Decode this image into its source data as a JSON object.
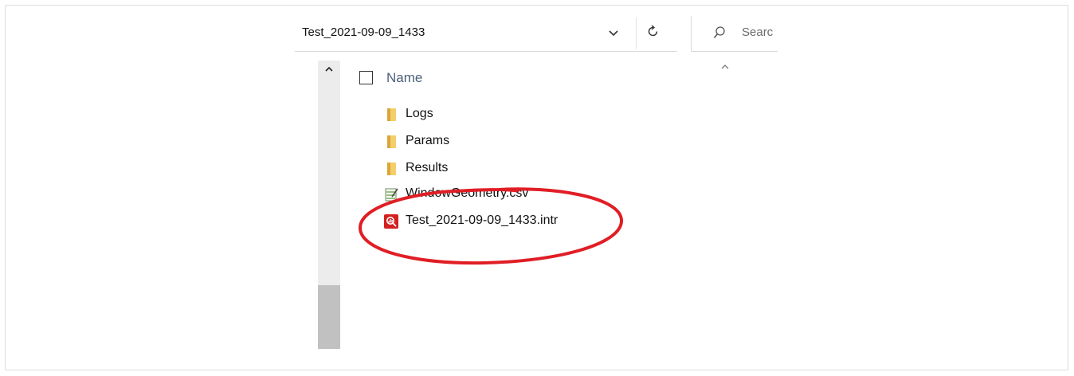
{
  "address_bar": {
    "path": "Test_2021-09-09_1433",
    "dropdown_icon": "chevron-down-icon",
    "refresh_icon": "refresh-icon"
  },
  "search": {
    "placeholder_visible": "Searc",
    "icon": "search-icon"
  },
  "file_list": {
    "column_header": "Name",
    "sort_direction": "ascending",
    "items": [
      {
        "name": "Logs",
        "type": "folder",
        "icon": "folder-icon"
      },
      {
        "name": "Params",
        "type": "folder",
        "icon": "folder-icon"
      },
      {
        "name": "Results",
        "type": "folder",
        "icon": "folder-icon"
      },
      {
        "name": "WindowGeometry.csv",
        "type": "csv",
        "icon": "csv-file-icon"
      },
      {
        "name": "Test_2021-09-09_1433.intr",
        "type": "intr",
        "icon": "intr-file-icon"
      }
    ]
  },
  "annotation": {
    "shape": "ellipse",
    "color": "#e01e25",
    "highlights": "Test_2021-09-09_1433.intr"
  },
  "colors": {
    "header_text": "#4c607a",
    "folder": "#e8b84a",
    "intr_icon": "#d42020"
  }
}
